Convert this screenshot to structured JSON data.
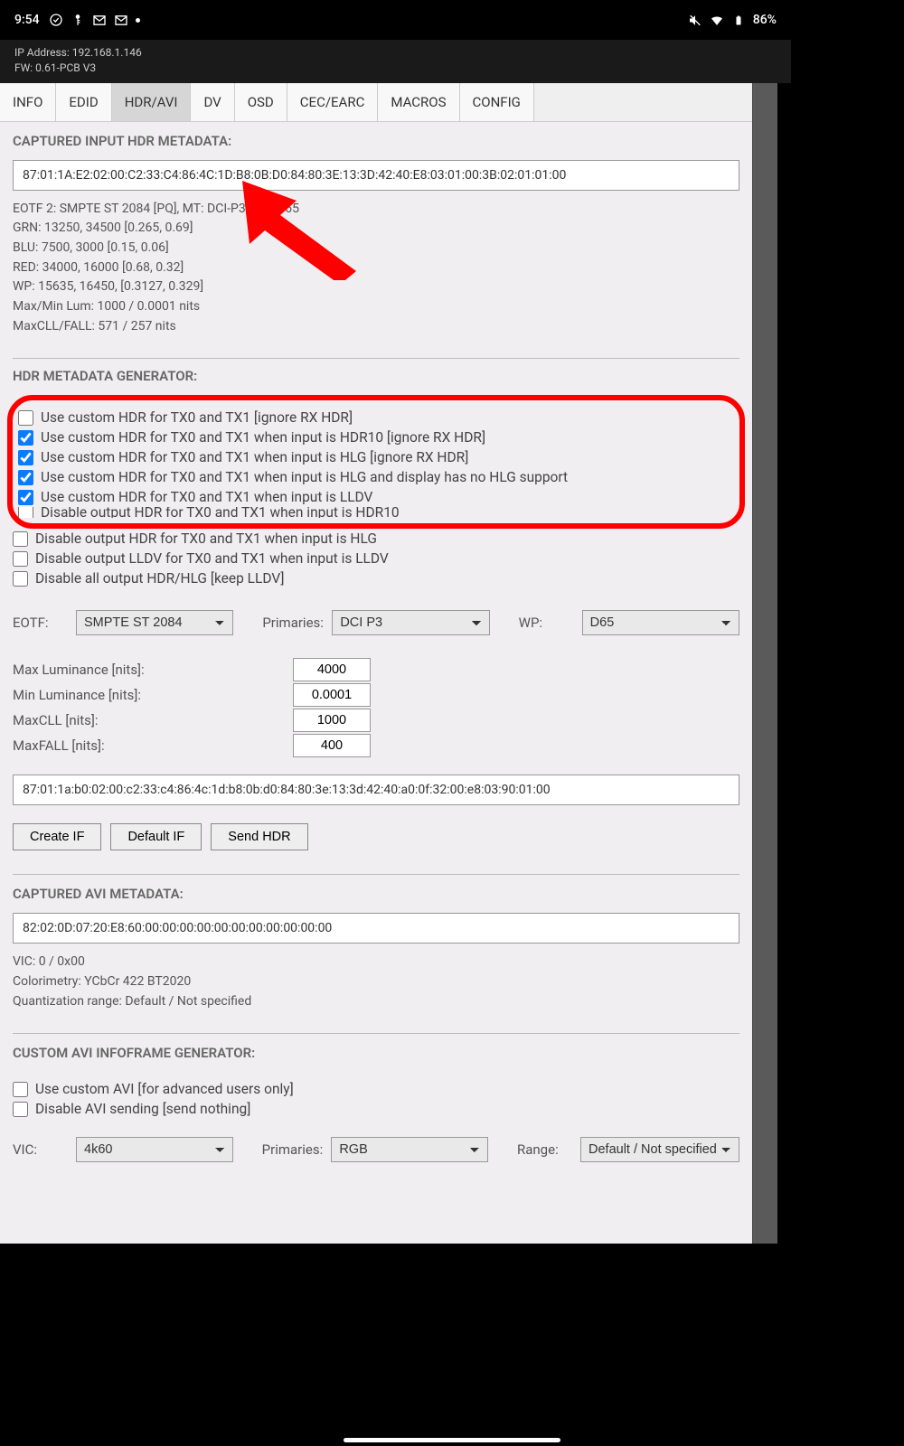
{
  "status": {
    "time": "9:54",
    "battery": "86%"
  },
  "device": {
    "ip": "IP Address: 192.168.1.146",
    "fw": "FW: 0.61-PCB V3"
  },
  "tabs": [
    "INFO",
    "EDID",
    "HDR/AVI",
    "DV",
    "OSD",
    "CEC/EARC",
    "MACROS",
    "CONFIG"
  ],
  "captured_hdr": {
    "title": "CAPTURED INPUT HDR METADATA:",
    "hex": "87:01:1A:E2:02:00:C2:33:C4:86:4C:1D:B8:0B:D0:84:80:3E:13:3D:42:40:E8:03:01:00:3B:02:01:01:00",
    "lines": {
      "eotf": "EOTF 2: SMPTE ST 2084 [PQ], MT: DCI-P3, WP: D65",
      "grn": "GRN: 13250, 34500 [0.265, 0.69]",
      "blu": "BLU: 7500, 3000 [0.15, 0.06]",
      "red": "RED: 34000, 16000 [0.68, 0.32]",
      "wp": "WP: 15635, 16450, [0.3127, 0.329]",
      "lum": "Max/Min Lum: 1000 / 0.0001 nits",
      "cll": "MaxCLL/FALL: 571 / 257 nits"
    }
  },
  "generator": {
    "title": "HDR METADATA GENERATOR:",
    "opts": {
      "c1": "Use custom HDR for TX0 and TX1 [ignore RX HDR]",
      "c2": "Use custom HDR for TX0 and TX1 when input is HDR10 [ignore RX HDR]",
      "c3": "Use custom HDR for TX0 and TX1 when input is HLG [ignore RX HDR]",
      "c4": "Use custom HDR for TX0 and TX1 when input is HLG and display has no HLG support",
      "c5": "Use custom HDR for TX0 and TX1 when input is LLDV",
      "c6": "Disable output HDR for TX0 and TX1 when input is HDR10",
      "c7": "Disable output HDR for TX0 and TX1 when input is HLG",
      "c8": "Disable output LLDV for TX0 and TX1 when input is LLDV",
      "c9": "Disable all output HDR/HLG [keep LLDV]"
    },
    "eotf_label": "EOTF:",
    "eotf": "SMPTE ST 2084",
    "prim_label": "Primaries:",
    "prim": "DCI P3",
    "wp_label": "WP:",
    "wp": "D65",
    "maxlum_label": "Max Luminance [nits]:",
    "maxlum": "4000",
    "minlum_label": "Min Luminance [nits]:",
    "minlum": "0.0001",
    "maxcll_label": "MaxCLL [nits]:",
    "maxcll": "1000",
    "maxfall_label": "MaxFALL [nits]:",
    "maxfall": "400",
    "hex2": "87:01:1a:b0:02:00:c2:33:c4:86:4c:1d:b8:0b:d0:84:80:3e:13:3d:42:40:a0:0f:32:00:e8:03:90:01:00",
    "btn_create": "Create IF",
    "btn_default": "Default IF",
    "btn_send": "Send HDR"
  },
  "captured_avi": {
    "title": "CAPTURED AVI METADATA:",
    "hex": "82:02:0D:07:20:E8:60:00:00:00:00:00:00:00:00:00:00:00",
    "lines": {
      "vic": "VIC: 0 / 0x00",
      "color": "Colorimetry: YCbCr 422 BT2020",
      "quant": "Quantization range: Default / Not specified"
    }
  },
  "custom_avi": {
    "title": "CUSTOM AVI INFOFRAME GENERATOR:",
    "c1": "Use custom AVI [for advanced users only]",
    "c2": "Disable AVI sending [send nothing]",
    "vic_label": "VIC:",
    "vic": "4k60",
    "prim_label": "Primaries:",
    "prim": "RGB",
    "range_label": "Range:",
    "range": "Default / Not specified"
  }
}
